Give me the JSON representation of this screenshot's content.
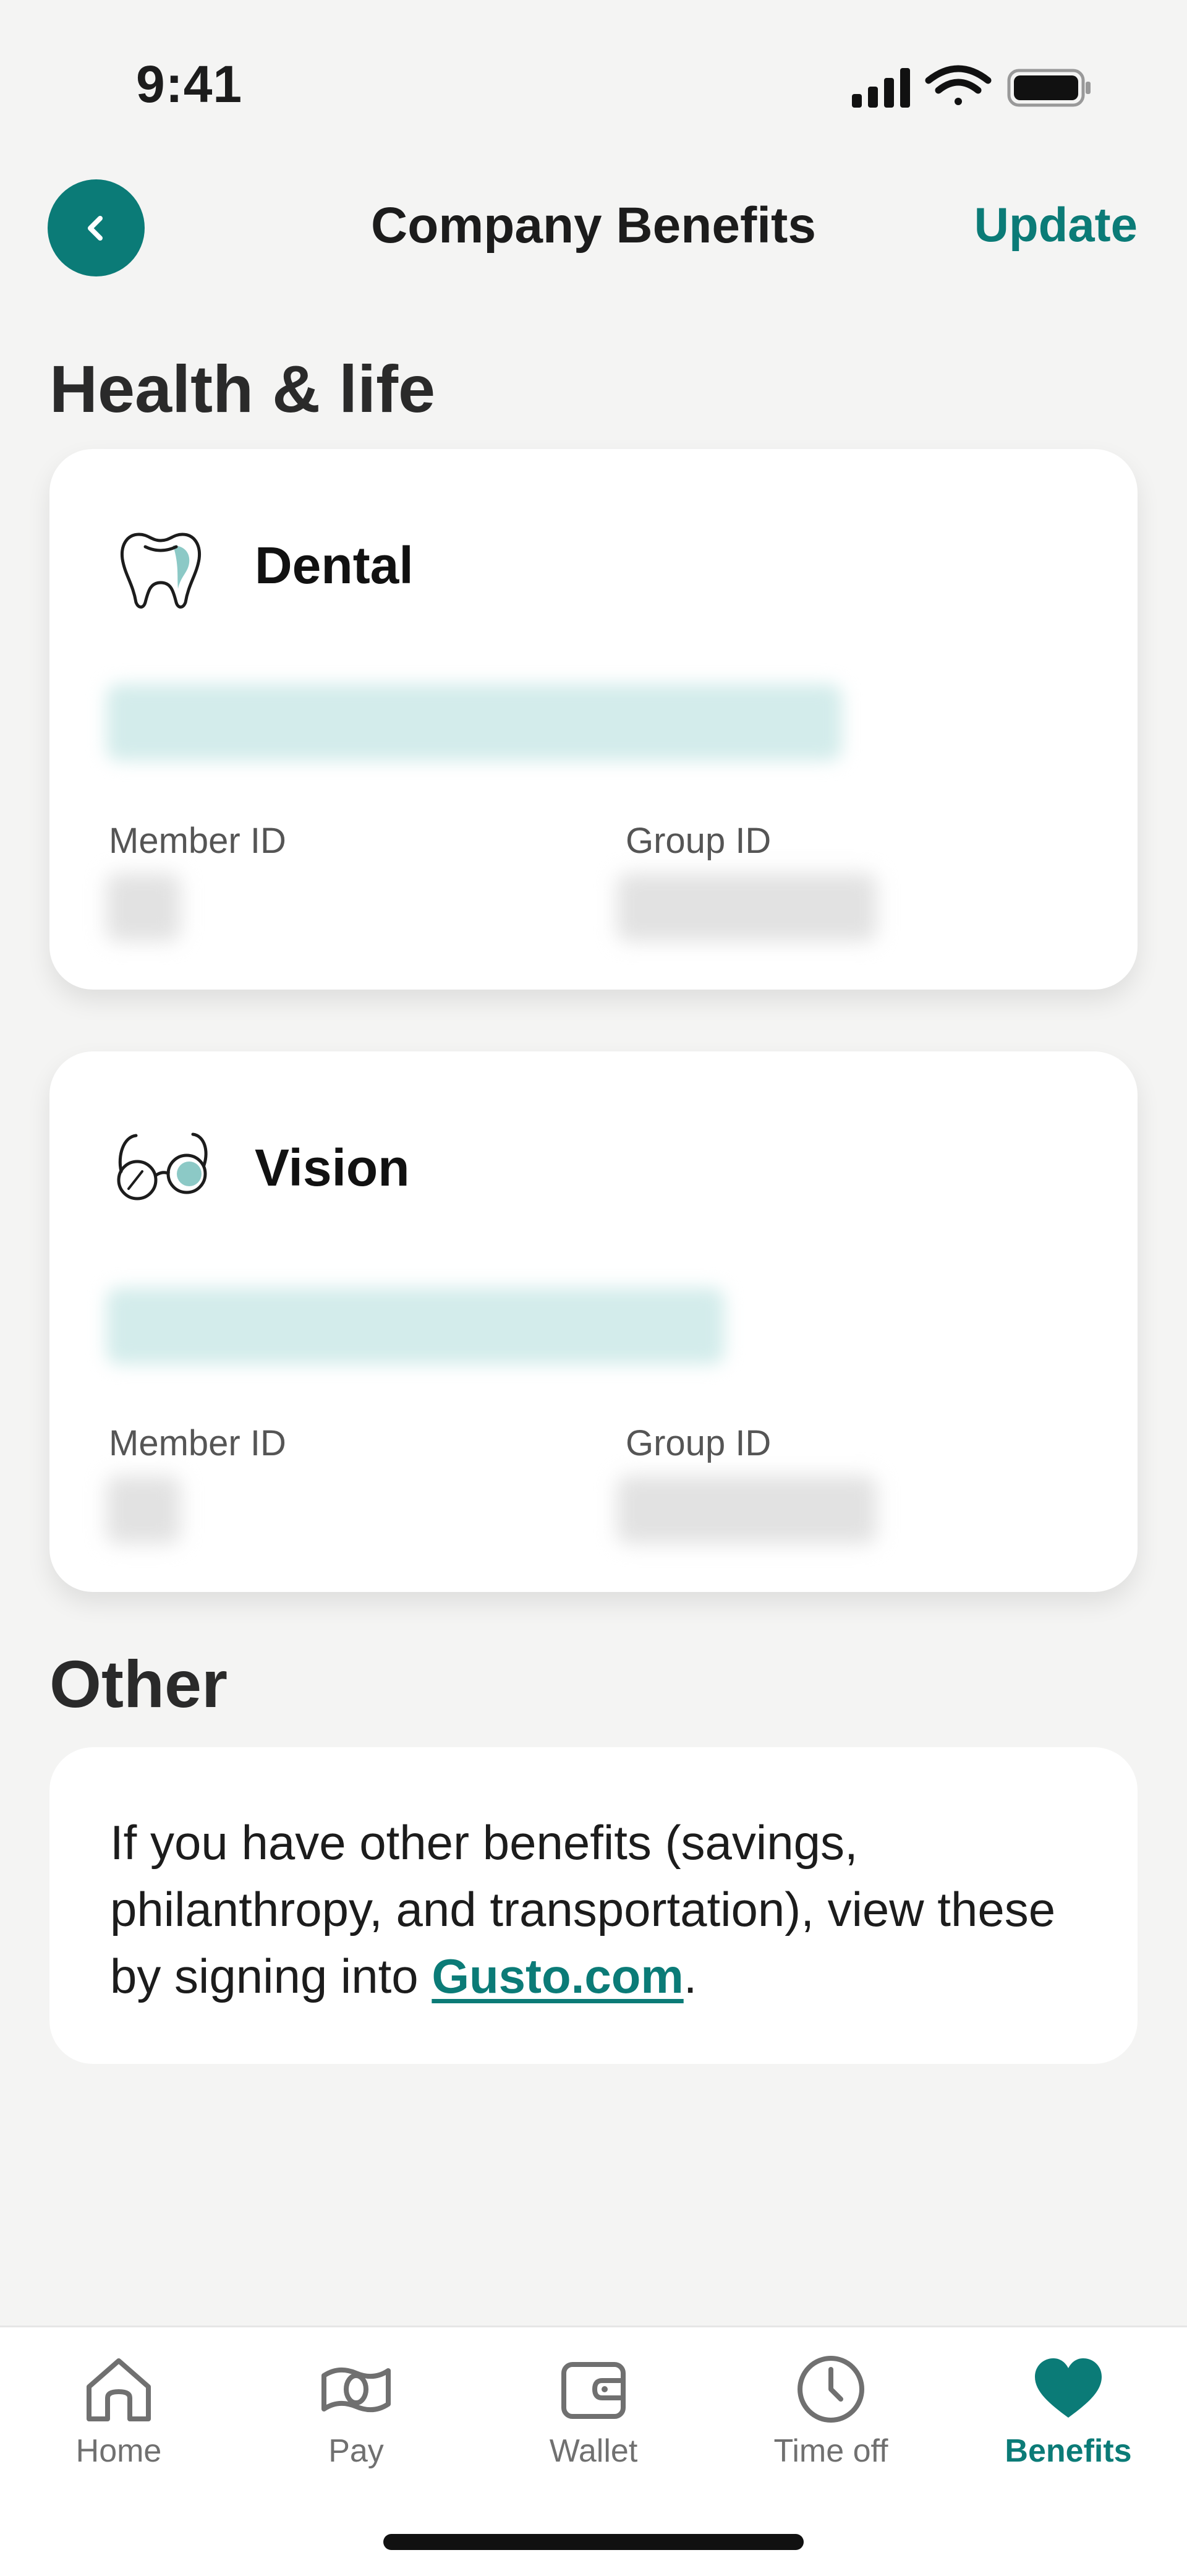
{
  "status": {
    "time": "9:41"
  },
  "header": {
    "title": "Company Benefits",
    "update_label": "Update",
    "back_label": "Back"
  },
  "sections": {
    "health": {
      "title": "Health & life"
    },
    "other": {
      "title": "Other"
    }
  },
  "cards": {
    "dental": {
      "title": "Dental",
      "member_label": "Member ID",
      "group_label": "Group ID"
    },
    "vision": {
      "title": "Vision",
      "member_label": "Member ID",
      "group_label": "Group ID"
    }
  },
  "other_card": {
    "text_before": "If you have other benefits (savings, philanthropy, and transportation), view these by signing into ",
    "link_text": "Gusto.com",
    "text_after": "."
  },
  "tabbar": {
    "items": [
      {
        "label": "Home",
        "icon": "home-icon"
      },
      {
        "label": "Pay",
        "icon": "pay-icon"
      },
      {
        "label": "Wallet",
        "icon": "wallet-icon"
      },
      {
        "label": "Time off",
        "icon": "clock-icon"
      },
      {
        "label": "Benefits",
        "icon": "heart-icon",
        "active": true
      }
    ]
  },
  "colors": {
    "accent": "#0b7b77",
    "redacted": "#d3eceb",
    "background": "#f4f4f3"
  }
}
